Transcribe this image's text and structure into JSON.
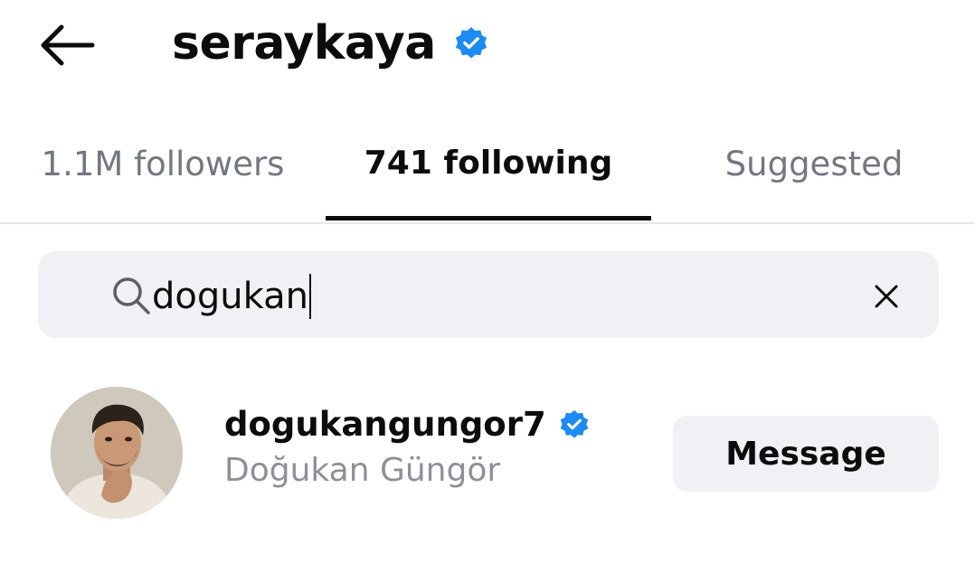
{
  "header": {
    "back_icon": "arrow-left-icon",
    "title": "seraykaya",
    "verified_icon": "verified-badge-icon"
  },
  "tabs": [
    {
      "label": "1.1M followers",
      "active": false
    },
    {
      "label": "741 following",
      "active": true
    },
    {
      "label": "Suggested",
      "active": false
    }
  ],
  "search": {
    "icon": "search-icon",
    "value": "dogukan",
    "clear_icon": "close-icon"
  },
  "results": [
    {
      "username": "dogukangungor7",
      "verified": true,
      "full_name": "Doğukan Güngör",
      "button_label": "Message"
    }
  ],
  "colors": {
    "verified_blue": "#1d8cf2",
    "muted_text": "#737780",
    "input_bg": "#eff1f4",
    "primary_text": "#0c0c0c"
  }
}
